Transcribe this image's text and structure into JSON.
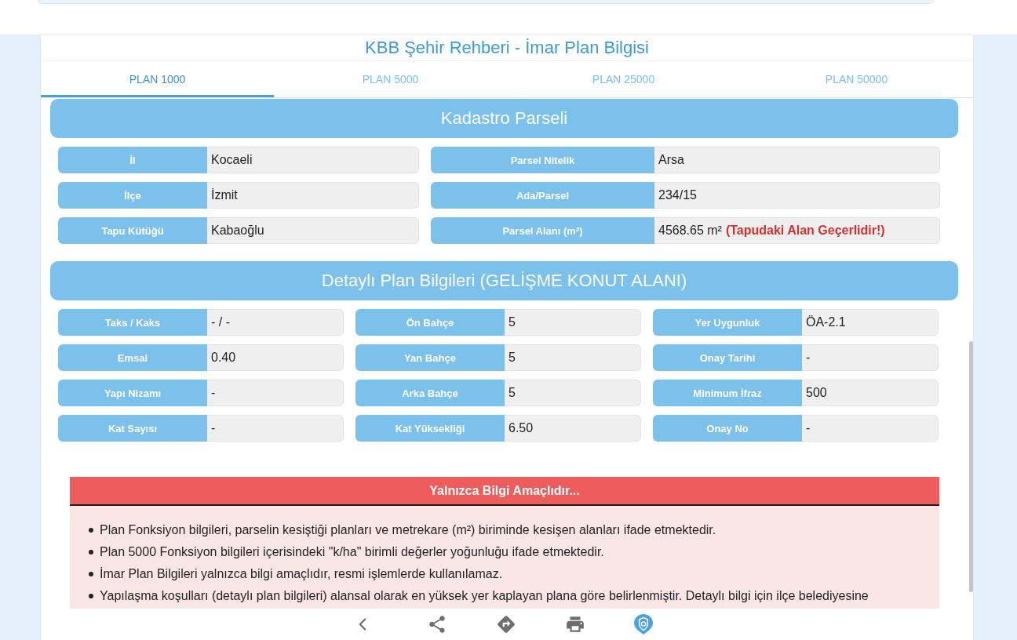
{
  "header": {
    "title": "KBB Şehir Rehberi - İmar Plan Bilgisi"
  },
  "tabs": [
    {
      "label": "PLAN 1000",
      "selected": true
    },
    {
      "label": "PLAN 5000",
      "selected": false
    },
    {
      "label": "PLAN 25000",
      "selected": false
    },
    {
      "label": "PLAN 50000",
      "selected": false
    }
  ],
  "sections": [
    {
      "title": "Kadastro Parseli",
      "kind": "two_column",
      "fields": [
        {
          "label": "İl",
          "value": "Kocaeli"
        },
        {
          "label": "Parsel Nitelik",
          "value": "Arsa"
        },
        {
          "label": "İlçe",
          "value": "İzmit"
        },
        {
          "label": "Ada/Parsel",
          "value": "234/15"
        },
        {
          "label": "Tapu Kütüğü",
          "value": "Kabaoğlu"
        },
        {
          "label": "Parsel Alanı (m²)",
          "value": "4568.65 m²",
          "note": "(Tapudaki Alan Geçerlidir!)"
        }
      ]
    },
    {
      "title": "Detaylı Plan Bilgileri (GELİŞME KONUT ALANI)",
      "kind": "three_column",
      "fields": [
        {
          "label": "Taks / Kaks",
          "value": "- / -"
        },
        {
          "label": "Ön Bahçe",
          "value": "5"
        },
        {
          "label": "Yer Uygunluk",
          "value": "ÖA-2.1"
        },
        {
          "label": "Emsal",
          "value": "0.40"
        },
        {
          "label": "Yan Bahçe",
          "value": "5"
        },
        {
          "label": "Onay Tarihi",
          "value": "-"
        },
        {
          "label": "Yapı Nizamı",
          "value": "-"
        },
        {
          "label": "Arka Bahçe",
          "value": "5"
        },
        {
          "label": "Minimum İfraz",
          "value": "500"
        },
        {
          "label": "Kat Sayısı",
          "value": "-"
        },
        {
          "label": "Kat Yüksekliği",
          "value": "6.50"
        },
        {
          "label": "Onay No",
          "value": "-"
        }
      ]
    }
  ],
  "notice": {
    "title": "Yalnızca Bilgi Amaçlıdır...",
    "items": [
      "Plan Fonksiyon bilgileri, parselin kesiştiği planları ve metrekare (m²) biriminde kesişen alanları ifade etmektedir.",
      "Plan 5000 Fonksiyon bilgileri içerisindeki \"k/ha\" birimli değerler yoğunluğu ifade etmektedir.",
      "İmar Plan Bilgileri yalnızca bilgi amaçlıdır, resmi işlemlerde kullanılamaz.",
      "Yapılaşma koşulları (detaylı plan bilgileri) alansal olarak en yüksek yer kaplayan plana göre belirlenmiştir. Detaylı bilgi için ilçe belediyesine"
    ]
  }
}
